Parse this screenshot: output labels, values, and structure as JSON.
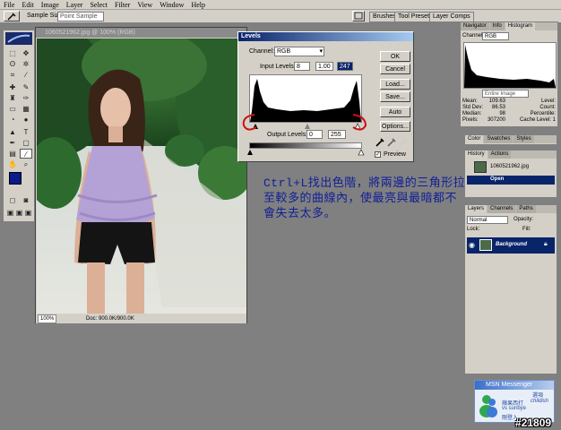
{
  "menu": [
    "File",
    "Edit",
    "Image",
    "Layer",
    "Select",
    "Filter",
    "View",
    "Window",
    "Help"
  ],
  "options_bar": {
    "sample_size_label": "Sample Size:",
    "sample_size_value": "Point Sample",
    "tabs": [
      "Brushes",
      "Tool Presets",
      "Layer Comps"
    ]
  },
  "document": {
    "title": "1060521962.jpg @ 100% (RGB)",
    "zoom": "100%",
    "doc_info": "Doc: 900.0K/900.0K"
  },
  "levels": {
    "title": "Levels",
    "channel_label": "Channel:",
    "channel_value": "RGB",
    "input_label": "Input Levels:",
    "input_black": "8",
    "input_gamma": "1.00",
    "input_white": "247",
    "output_label": "Output Levels:",
    "output_black": "0",
    "output_white": "255",
    "buttons": [
      "OK",
      "Cancel",
      "Load...",
      "Save...",
      "Auto",
      "Options..."
    ],
    "preview_label": "Preview"
  },
  "navigator": {
    "tabs": [
      "Navigator",
      "Info",
      "Histogram"
    ],
    "channel_label": "Channel:",
    "channel_value": "RGB",
    "source_value": "Entire Image",
    "stats_left": [
      [
        "Mean:",
        "109.63"
      ],
      [
        "Std Dev:",
        "86.53"
      ],
      [
        "Median:",
        "98"
      ],
      [
        "Pixels:",
        "307200"
      ]
    ],
    "stats_right": [
      [
        "Level:",
        ""
      ],
      [
        "Count:",
        ""
      ],
      [
        "Percentile:",
        ""
      ],
      [
        "Cache Level:",
        "1"
      ]
    ]
  },
  "color_panel": {
    "tabs": [
      "Color",
      "Swatches",
      "Styles"
    ]
  },
  "history_panel": {
    "tabs": [
      "History",
      "Actions"
    ],
    "snapshot": "1060521962.jpg",
    "step": "Open"
  },
  "layers_panel": {
    "tabs": [
      "Layers",
      "Channels",
      "Paths"
    ],
    "blend_mode": "Normal",
    "opacity_label": "Opacity:",
    "lock_label": "Lock:",
    "fill_label": "Fill:",
    "layer_name": "Background"
  },
  "annotation": "Ctrl+L找出色階，將兩邊的三角形拉至較多的曲線內，使最亮與最暗都不會失去太多。",
  "msn": {
    "title": "MSN Messenger",
    "line1": "蘋果西打",
    "line2": "childish",
    "line3": "vs sunbye",
    "line4": "剛登入。",
    "options": "選項"
  },
  "watermark": "#21809",
  "colors": {
    "annotation": "#0f1f96",
    "selection": "#0a246a",
    "annotation_circles": "#cc1111"
  }
}
